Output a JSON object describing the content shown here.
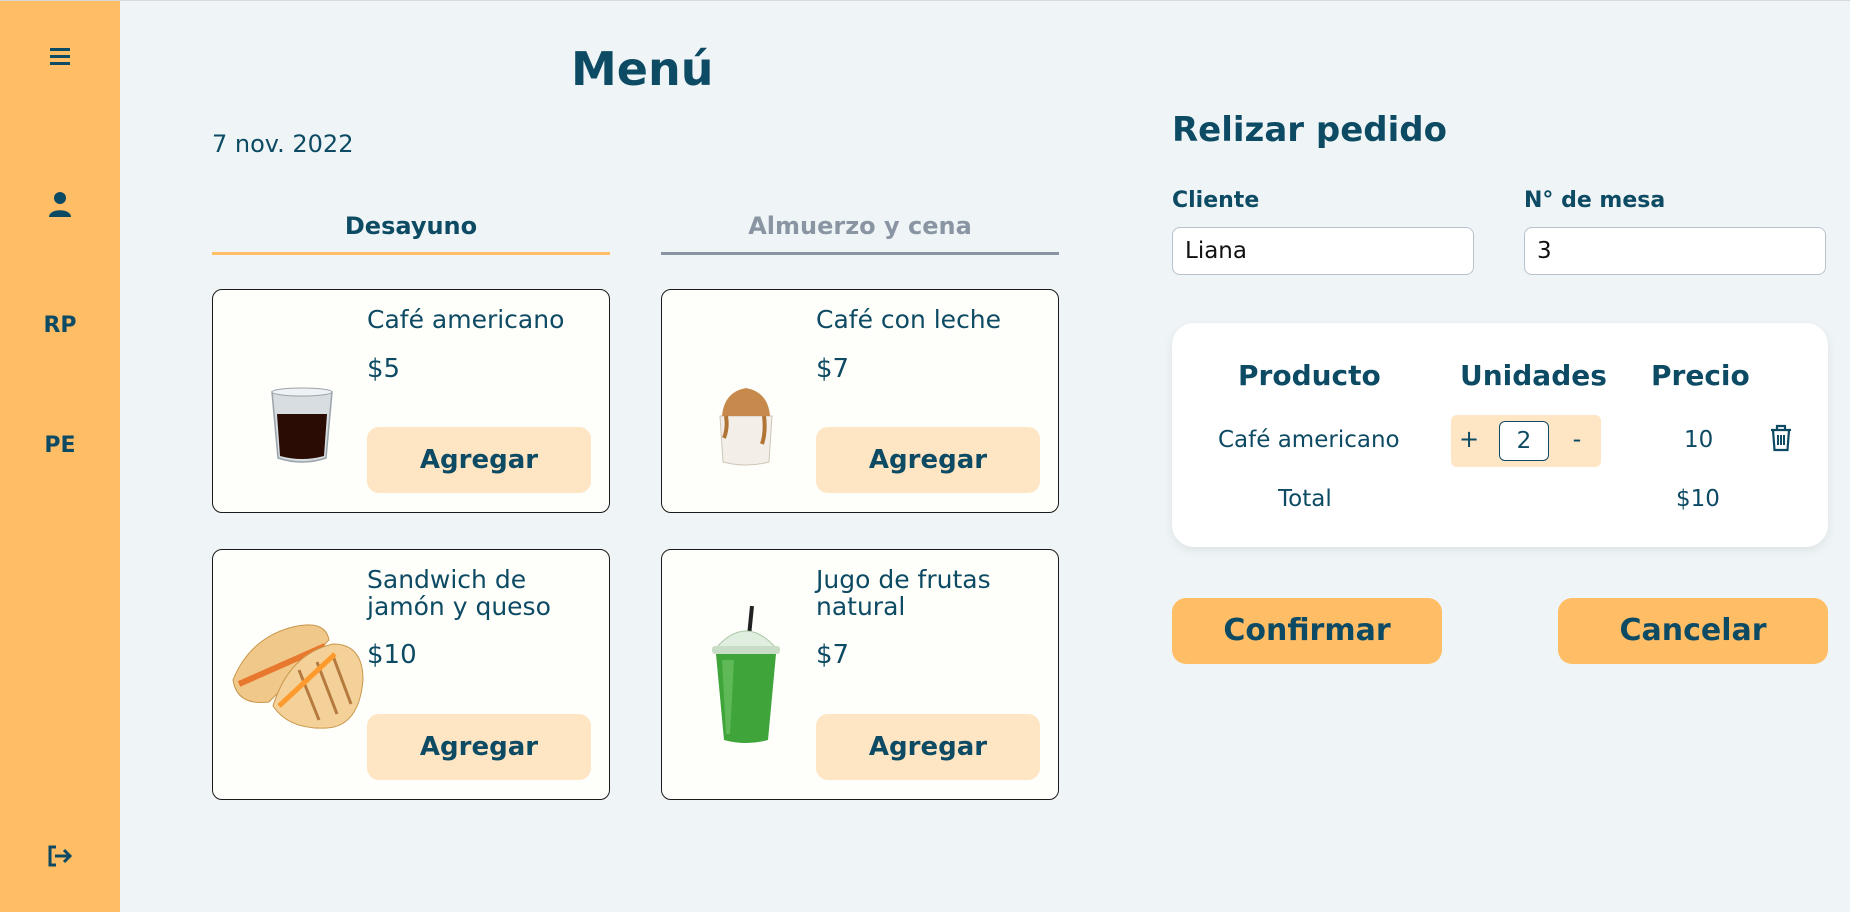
{
  "sidebar": {
    "menu_icon": "hamburger-menu-icon",
    "user_icon": "user-icon",
    "rp_label": "RP",
    "pe_label": "PE",
    "logout_icon": "logout-icon"
  },
  "header": {
    "title": "Menú",
    "date": "7 nov. 2022"
  },
  "tabs": [
    {
      "label": "Desayuno",
      "active": true
    },
    {
      "label": "Almuerzo y cena",
      "active": false
    }
  ],
  "products": [
    {
      "name": "Café americano",
      "price": "$5",
      "button": "Agregar",
      "image": "glass-of-black-coffee"
    },
    {
      "name": "Café con leche",
      "price": "$7",
      "button": "Agregar",
      "image": "glass-of-latte"
    },
    {
      "name": "Sandwich de jamón y queso",
      "price": "$10",
      "button": "Agregar",
      "image": "grilled-ham-cheese-sandwich"
    },
    {
      "name": "Jugo de frutas natural",
      "price": "$7",
      "button": "Agregar",
      "image": "green-juice-cup"
    }
  ],
  "order": {
    "title": "Relizar pedido",
    "client_label": "Cliente",
    "client_value": "Liana",
    "table_label": "N° de mesa",
    "table_value": "3",
    "columns": [
      "Producto",
      "Unidades",
      "Precio"
    ],
    "items": [
      {
        "product": "Café americano",
        "plus": "+",
        "units": "2",
        "minus": "-",
        "price": "10",
        "delete_icon": "trash-icon"
      }
    ],
    "total_label": "Total",
    "total_value": "$10",
    "confirm_label": "Confirmar",
    "cancel_label": "Cancelar"
  },
  "colors": {
    "accent": "#ffbe66",
    "accent_light": "#fee5c3",
    "text": "#0d4a63",
    "inactive": "#8a95a3",
    "background": "#eff5f6"
  }
}
